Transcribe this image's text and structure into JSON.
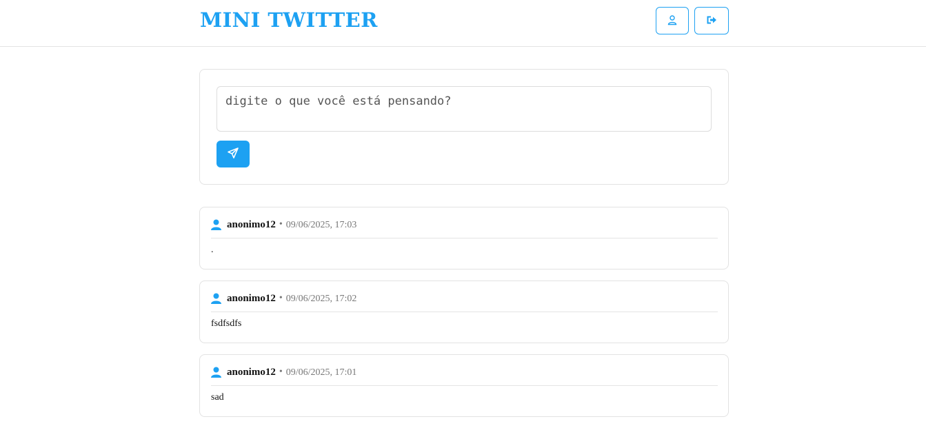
{
  "header": {
    "logo": "MINI TWITTER",
    "profile_icon": "user-icon",
    "logout_icon": "logout-icon"
  },
  "composer": {
    "placeholder": "digite o que você está pensando?",
    "value": "",
    "send_icon": "send-icon"
  },
  "posts": [
    {
      "username": "anonimo12",
      "separator": "•",
      "timestamp": "09/06/2025, 17:03",
      "content": "."
    },
    {
      "username": "anonimo12",
      "separator": "•",
      "timestamp": "09/06/2025, 17:02",
      "content": "fsdfsdfs"
    },
    {
      "username": "anonimo12",
      "separator": "•",
      "timestamp": "09/06/2025, 17:01",
      "content": "sad"
    }
  ],
  "colors": {
    "accent": "#1da1f2",
    "border": "#e2e2e2",
    "muted": "#777777"
  }
}
